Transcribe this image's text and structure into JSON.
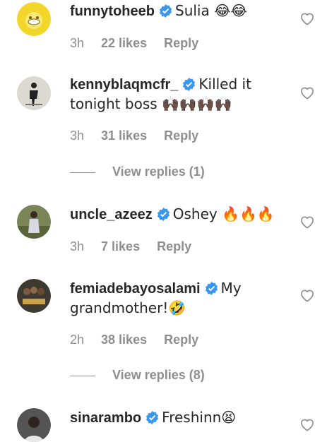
{
  "comments": [
    {
      "username": "funnytoheeb",
      "text": "Sulia 😂😂",
      "time": "3h",
      "likes": "22 likes",
      "reply": "Reply",
      "avatar_color": "#f3d62a"
    },
    {
      "username": "kennyblaqmcfr_",
      "text": "Killed it tonight boss 🙌🏿🙌🏿🙌🏿🙌🏿",
      "time": "3h",
      "likes": "31 likes",
      "reply": "Reply",
      "view_replies": "View replies (1)",
      "avatar_color": "#d9d6cf"
    },
    {
      "username": "uncle_azeez",
      "text": "Oshey 🔥🔥🔥",
      "time": "3h",
      "likes": "7 likes",
      "reply": "Reply",
      "avatar_color": "#6f7a4a"
    },
    {
      "username": "femiadebayosalami",
      "text": "My grandmother!🤣",
      "time": "2h",
      "likes": "38 likes",
      "reply": "Reply",
      "view_replies": "View replies (8)",
      "avatar_color": "#3e3a32"
    },
    {
      "username": "sinarambo",
      "text": "Freshinn😫",
      "avatar_color": "#555555"
    }
  ],
  "colors": {
    "verified": "#3897f0",
    "muted": "#8e8e8e"
  }
}
